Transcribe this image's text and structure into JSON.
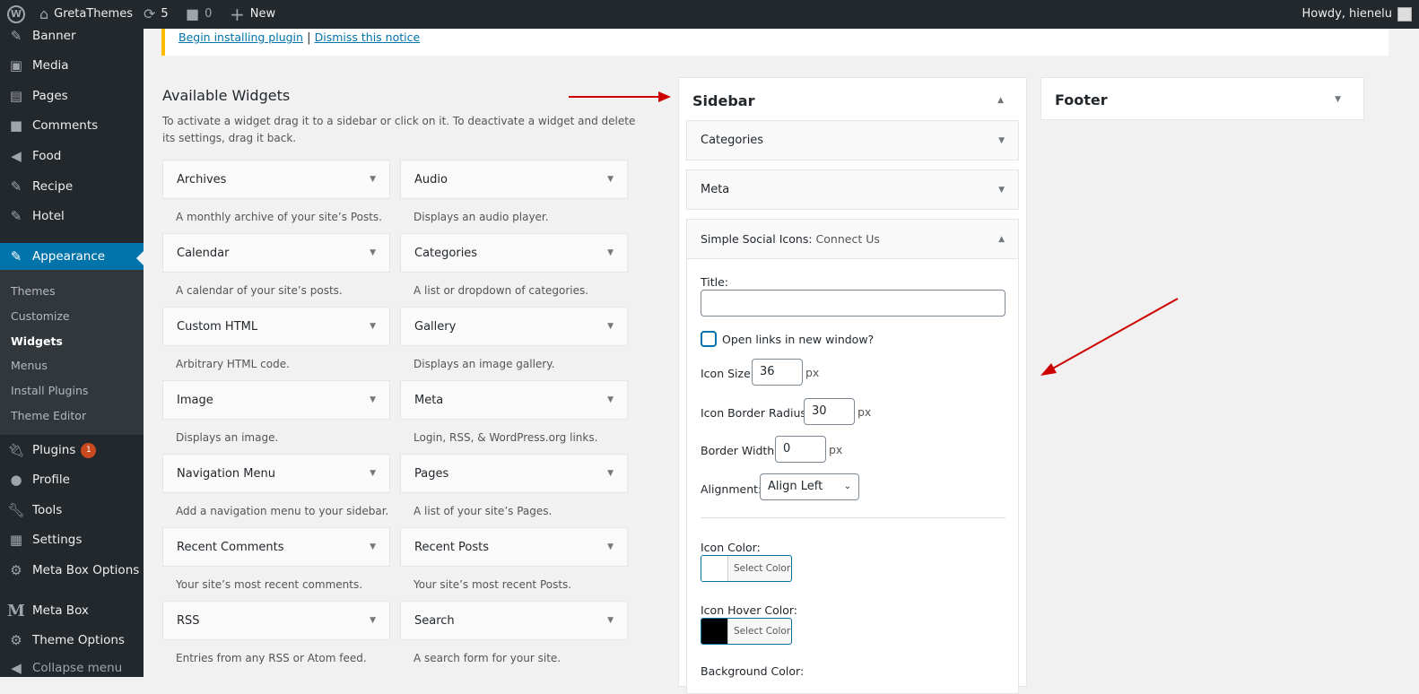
{
  "adminbar": {
    "site": "GretaThemes",
    "updates": "5",
    "comments": "0",
    "new": "New",
    "howdy": "Howdy, hienelu"
  },
  "menu": {
    "items": [
      {
        "label": "Banner",
        "icon": "pin-icon"
      },
      {
        "label": "Media",
        "icon": "media-icon"
      },
      {
        "label": "Pages",
        "icon": "pages-icon"
      },
      {
        "label": "Comments",
        "icon": "comments-icon"
      },
      {
        "label": "Food",
        "icon": "food-icon"
      },
      {
        "label": "Recipe",
        "icon": "recipe-icon"
      },
      {
        "label": "Hotel",
        "icon": "pin-icon"
      },
      {
        "label": "Appearance",
        "icon": "brush-icon"
      }
    ],
    "submenu": [
      "Themes",
      "Customize",
      "Widgets",
      "Menus",
      "Install Plugins",
      "Theme Editor"
    ],
    "items2": [
      {
        "label": "Plugins",
        "badge": "1"
      },
      {
        "label": "Profile"
      },
      {
        "label": "Tools"
      },
      {
        "label": "Settings"
      },
      {
        "label": "Meta Box Options"
      },
      {
        "label": "Meta Box"
      },
      {
        "label": "Theme Options"
      },
      {
        "label": "Collapse menu"
      }
    ]
  },
  "notice": {
    "install": "Begin installing plugin",
    "sep": "|",
    "dismiss": "Dismiss this notice"
  },
  "available": {
    "title": "Available Widgets",
    "desc": "To activate a widget drag it to a sidebar or click on it. To deactivate a widget and delete its settings, drag it back.",
    "widgets": [
      {
        "name": "Archives",
        "desc": "A monthly archive of your site’s Posts."
      },
      {
        "name": "Audio",
        "desc": "Displays an audio player."
      },
      {
        "name": "Calendar",
        "desc": "A calendar of your site’s posts."
      },
      {
        "name": "Categories",
        "desc": "A list or dropdown of categories."
      },
      {
        "name": "Custom HTML",
        "desc": "Arbitrary HTML code."
      },
      {
        "name": "Gallery",
        "desc": "Displays an image gallery."
      },
      {
        "name": "Image",
        "desc": "Displays an image."
      },
      {
        "name": "Meta",
        "desc": "Login, RSS, & WordPress.org links."
      },
      {
        "name": "Navigation Menu",
        "desc": "Add a navigation menu to your sidebar."
      },
      {
        "name": "Pages",
        "desc": "A list of your site’s Pages."
      },
      {
        "name": "Recent Comments",
        "desc": "Your site’s most recent comments."
      },
      {
        "name": "Recent Posts",
        "desc": "Your site’s most recent Posts."
      },
      {
        "name": "RSS",
        "desc": "Entries from any RSS or Atom feed."
      },
      {
        "name": "Search",
        "desc": "A search form for your site."
      }
    ]
  },
  "sidebar": {
    "title": "Sidebar",
    "widgets": [
      "Categories",
      "Meta"
    ],
    "ssi": {
      "name": "Simple Social Icons:",
      "subtitle": "Connect Us",
      "title_label": "Title:",
      "title_value": "",
      "newwin": "Open links in new window?",
      "size_label": "Icon Size:",
      "size": "36",
      "px": "px",
      "radius_label": "Icon Border Radius:",
      "radius": "30",
      "border_label": "Border Width:",
      "border": "0",
      "align_label": "Alignment:",
      "align": "Align Left",
      "icon_color_label": "Icon Color:",
      "hover_label": "Icon Hover Color:",
      "select_color": "Select Color",
      "bg_label": "Background Color:",
      "icon_color": "#ffffff",
      "hover_color": "#000000"
    }
  },
  "footer": {
    "title": "Footer"
  }
}
